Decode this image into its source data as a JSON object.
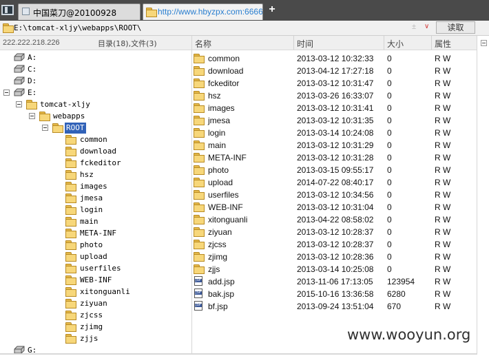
{
  "tabs": [
    {
      "label": "中国菜刀@20100928",
      "active": false
    },
    {
      "label": "http://www.hbyzpx.com:6666...",
      "active": true
    }
  ],
  "new_tab_label": "+",
  "address": {
    "path": "E:\\tomcat-xljy\\webapps\\ROOT\\",
    "dropdown_plus": "±",
    "dropdown_chevron": "∨",
    "read_button": "读取"
  },
  "info": {
    "ip": "222.222.218.226",
    "counts": "目录(18),文件(3)"
  },
  "tree": {
    "drives": [
      {
        "label": "A:"
      },
      {
        "label": "C:"
      },
      {
        "label": "D:"
      },
      {
        "label": "E:"
      },
      {
        "label": "G:"
      }
    ],
    "tomcat": "tomcat-xljy",
    "webapps": "webapps",
    "root": "ROOT",
    "folders": [
      "common",
      "download",
      "fckeditor",
      "hsz",
      "images",
      "jmesa",
      "login",
      "main",
      "META-INF",
      "photo",
      "upload",
      "userfiles",
      "WEB-INF",
      "xitonguanli",
      "ziyuan",
      "zjcss",
      "zjimg",
      "zjjs"
    ]
  },
  "list": {
    "columns": {
      "name": "名称",
      "time": "时间",
      "size": "大小",
      "attr": "属性"
    },
    "rows": [
      {
        "type": "folder",
        "name": "common",
        "time": "2013-03-12 10:32:33",
        "size": "0",
        "attr": "R W"
      },
      {
        "type": "folder",
        "name": "download",
        "time": "2013-04-12 17:27:18",
        "size": "0",
        "attr": "R W"
      },
      {
        "type": "folder",
        "name": "fckeditor",
        "time": "2013-03-12 10:31:47",
        "size": "0",
        "attr": "R W"
      },
      {
        "type": "folder",
        "name": "hsz",
        "time": "2013-03-26 16:33:07",
        "size": "0",
        "attr": "R W"
      },
      {
        "type": "folder",
        "name": "images",
        "time": "2013-03-12 10:31:41",
        "size": "0",
        "attr": "R W"
      },
      {
        "type": "folder",
        "name": "jmesa",
        "time": "2013-03-12 10:31:35",
        "size": "0",
        "attr": "R W"
      },
      {
        "type": "folder",
        "name": "login",
        "time": "2013-03-14 10:24:08",
        "size": "0",
        "attr": "R W"
      },
      {
        "type": "folder",
        "name": "main",
        "time": "2013-03-12 10:31:29",
        "size": "0",
        "attr": "R W"
      },
      {
        "type": "folder",
        "name": "META-INF",
        "time": "2013-03-12 10:31:28",
        "size": "0",
        "attr": "R W"
      },
      {
        "type": "folder",
        "name": "photo",
        "time": "2013-03-15 09:55:17",
        "size": "0",
        "attr": "R W"
      },
      {
        "type": "folder",
        "name": "upload",
        "time": "2014-07-22 08:40:17",
        "size": "0",
        "attr": "R W"
      },
      {
        "type": "folder",
        "name": "userfiles",
        "time": "2013-03-12 10:34:56",
        "size": "0",
        "attr": "R W"
      },
      {
        "type": "folder",
        "name": "WEB-INF",
        "time": "2013-03-12 10:31:04",
        "size": "0",
        "attr": "R W"
      },
      {
        "type": "folder",
        "name": "xitonguanli",
        "time": "2013-04-22 08:58:02",
        "size": "0",
        "attr": "R W"
      },
      {
        "type": "folder",
        "name": "ziyuan",
        "time": "2013-03-12 10:28:37",
        "size": "0",
        "attr": "R W"
      },
      {
        "type": "folder",
        "name": "zjcss",
        "time": "2013-03-12 10:28:37",
        "size": "0",
        "attr": "R W"
      },
      {
        "type": "folder",
        "name": "zjimg",
        "time": "2013-03-12 10:28:36",
        "size": "0",
        "attr": "R W"
      },
      {
        "type": "folder",
        "name": "zjjs",
        "time": "2013-03-14 10:25:08",
        "size": "0",
        "attr": "R W"
      },
      {
        "type": "file",
        "name": "add.jsp",
        "time": "2013-11-06 17:13:05",
        "size": "123954",
        "attr": "R W"
      },
      {
        "type": "file",
        "name": "bak.jsp",
        "time": "2015-10-16 13:36:58",
        "size": "6280",
        "attr": "R W"
      },
      {
        "type": "file",
        "name": "bf.jsp",
        "time": "2013-09-24 13:51:04",
        "size": "670",
        "attr": "R W"
      }
    ]
  },
  "watermark": "www.wooyun.org",
  "colors": {
    "selection": "#3162b8",
    "link": "#2a7fd0",
    "folder": "#f7d77a",
    "tabbar": "#4a4a4a"
  }
}
